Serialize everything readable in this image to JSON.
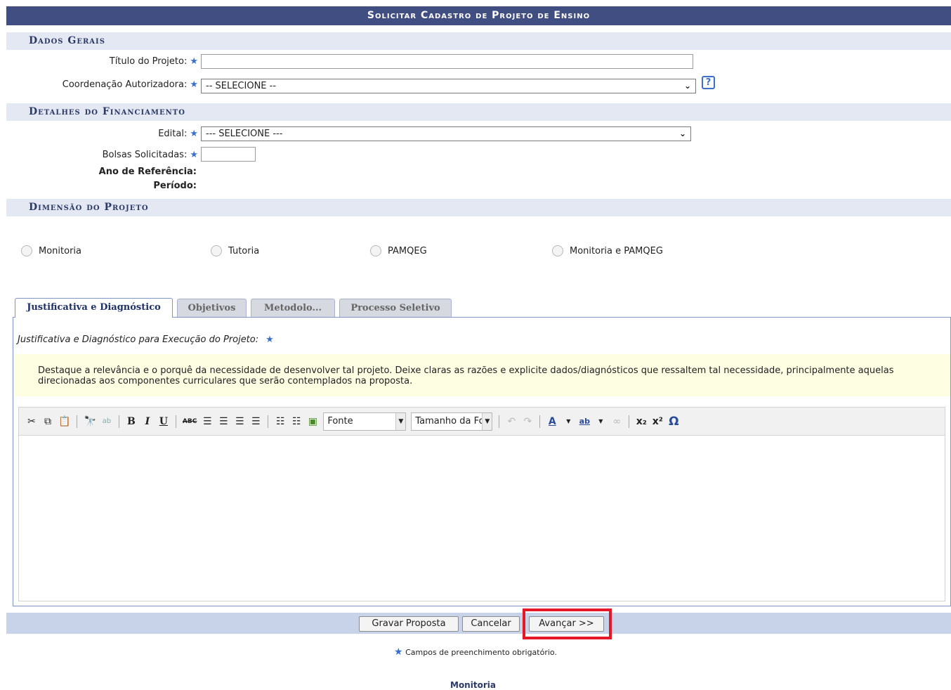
{
  "caption": "Solicitar Cadastro de Projeto de Ensino",
  "sections": {
    "dados_gerais": "Dados Gerais",
    "financiamento": "Detalhes do Financiamento",
    "dimensao": "Dimensão do Projeto"
  },
  "form": {
    "titulo_label": "Título do Projeto:",
    "titulo_value": "",
    "coordenacao_label": "Coordenação Autorizadora:",
    "coordenacao_selected": "-- SELECIONE --",
    "help_icon": "?",
    "edital_label": "Edital:",
    "edital_selected": "--- SELECIONE ---",
    "bolsas_label": "Bolsas Solicitadas:",
    "bolsas_value": "",
    "ano_label": "Ano de Referência:",
    "periodo_label": "Período:",
    "star": "★"
  },
  "radios": [
    {
      "label": "Monitoria"
    },
    {
      "label": "Tutoria"
    },
    {
      "label": "PAMQEG"
    },
    {
      "label": "Monitoria e PAMQEG"
    }
  ],
  "tabs": [
    {
      "label": "Justificativa e Diagnóstico",
      "active": true
    },
    {
      "label": "Objetivos",
      "active": false
    },
    {
      "label": "Metodolo...",
      "active": false
    },
    {
      "label": "Processo Seletivo",
      "active": false
    }
  ],
  "panel": {
    "label": "Justificativa e Diagnóstico para Execução do Projeto:",
    "hint": "Destaque a relevância e o porquê da necessidade de desenvolver tal projeto. Deixe claras as razões e explicite dados/diagnósticos que ressaltem tal necessidade, principalmente aquelas direcionadas aos componentes curriculares que serão contemplados na proposta."
  },
  "editor": {
    "font_combo": "Fonte",
    "size_combo": "Tamanho da Fo",
    "icons": [
      "cut-icon",
      "copy-icon",
      "paste-icon",
      "find-icon",
      "replace-icon",
      "bold-icon",
      "italic-icon",
      "underline-icon",
      "strikethrough-icon",
      "align-left-icon",
      "align-center-icon",
      "align-right-icon",
      "justify-icon",
      "bullet-list-icon",
      "numbered-list-icon",
      "image-icon",
      "undo-icon",
      "redo-icon",
      "text-color-icon",
      "highlight-color-icon",
      "link-icon",
      "subscript-icon",
      "superscript-icon",
      "special-char-icon"
    ]
  },
  "buttons": {
    "gravar": "Gravar Proposta",
    "cancelar": "Cancelar",
    "avancar": "Avançar >>"
  },
  "footer": {
    "required_note": "Campos de preenchimento obrigatório.",
    "bottom_link": "Monitoria"
  },
  "colors": {
    "caption_bg": "#404e82",
    "section_bg": "#e4e8f3",
    "footer_bg": "#c8d2e8",
    "hint_bg": "#fefee3",
    "highlight": "#e5182a",
    "star": "#3b6fc9"
  }
}
